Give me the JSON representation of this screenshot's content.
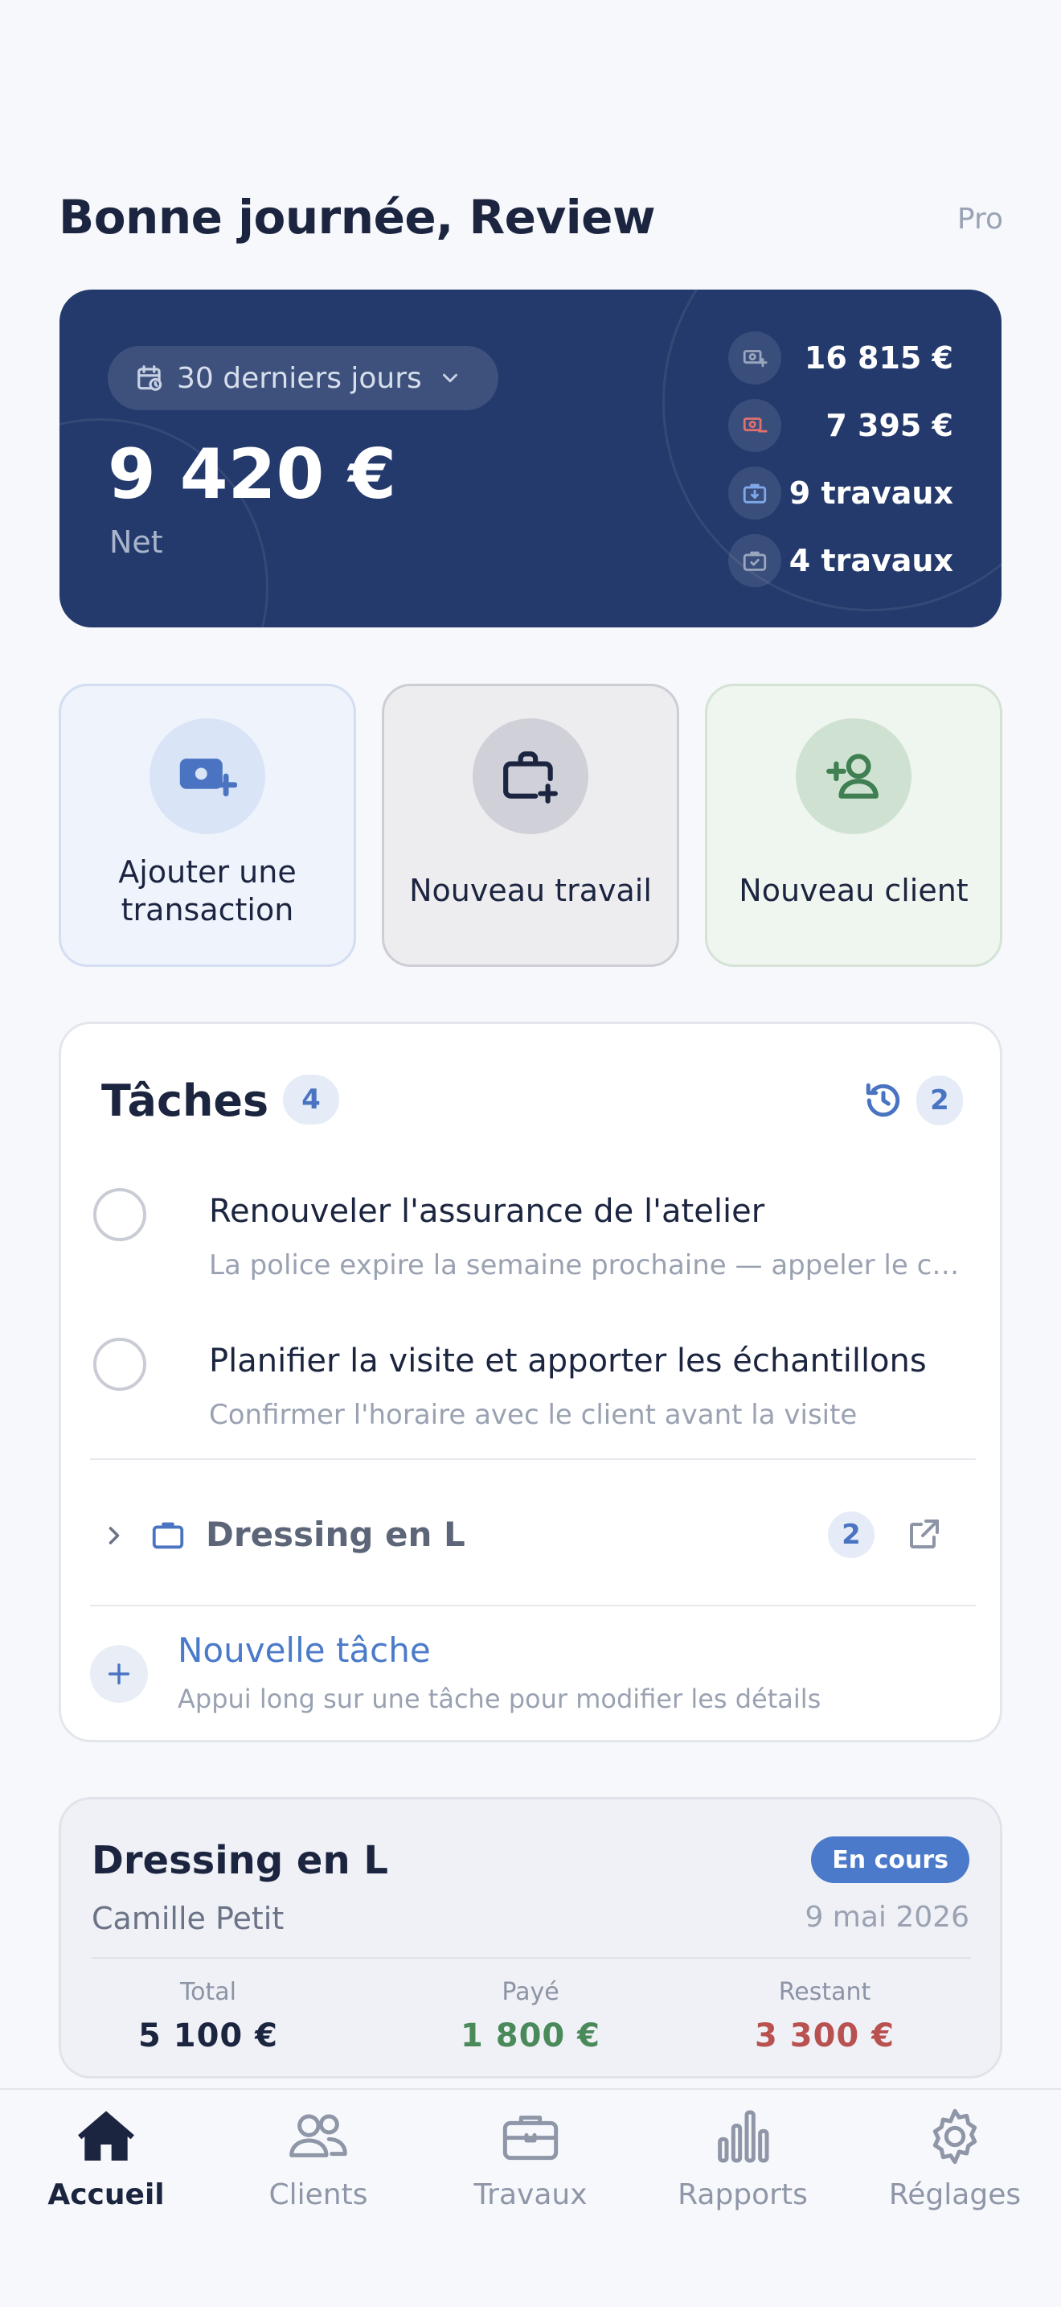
{
  "header": {
    "greeting": "Bonne journée, Review",
    "plan": "Pro"
  },
  "summary": {
    "period": "30 derniers jours",
    "net_amount": "9 420 €",
    "net_label": "Net",
    "stats": [
      {
        "icon": "money-in-icon",
        "value": "16 815 €",
        "color": "#9aa6bd"
      },
      {
        "icon": "money-out-icon",
        "value": "7 395 €",
        "color": "#e06f6f"
      },
      {
        "icon": "briefcase-in-icon",
        "value": "9 travaux",
        "color": "#7fa8ea"
      },
      {
        "icon": "briefcase-done-icon",
        "value": "4 travaux",
        "color": "#9aa6bd"
      }
    ],
    "background": "#243a6c"
  },
  "actions": [
    {
      "label": "Ajouter une transaction",
      "icon": "add-money-icon",
      "color": "#4a74c2"
    },
    {
      "label": "Nouveau travail",
      "icon": "new-job-icon",
      "color": "#1c2540"
    },
    {
      "label": "Nouveau client",
      "icon": "add-person-icon",
      "color": "#3f7f52"
    }
  ],
  "tasks": {
    "title": "Tâches",
    "count": "4",
    "overdue_count": "2",
    "items": [
      {
        "title": "Renouveler l'assurance de l'atelier",
        "subtitle": "La police expire la semaine prochaine — appeler le courtier"
      },
      {
        "title": "Planifier la visite et apporter les échantillons",
        "subtitle": "Confirmer l'horaire avec le client avant la visite"
      }
    ],
    "group": {
      "name": "Dressing en L",
      "count": "2"
    },
    "new_task": {
      "title": "Nouvelle tâche",
      "hint": "Appui long sur une tâche pour modifier les détails"
    }
  },
  "job": {
    "title": "Dressing en L",
    "status": "En cours",
    "client": "Camille Petit",
    "date": "9 mai 2026",
    "totals": [
      {
        "label": "Total",
        "value": "5 100 €",
        "color": "#1c2540"
      },
      {
        "label": "Payé",
        "value": "1 800 €",
        "color": "#4a8a5a"
      },
      {
        "label": "Restant",
        "value": "3 300 €",
        "color": "#b8514f"
      }
    ]
  },
  "tabbar": {
    "items": [
      {
        "label": "Accueil",
        "icon": "home-icon",
        "active": true
      },
      {
        "label": "Clients",
        "icon": "people-icon",
        "active": false
      },
      {
        "label": "Travaux",
        "icon": "briefcase-icon",
        "active": false
      },
      {
        "label": "Rapports",
        "icon": "bar-chart-icon",
        "active": false
      },
      {
        "label": "Réglages",
        "icon": "gear-icon",
        "active": false
      }
    ]
  }
}
